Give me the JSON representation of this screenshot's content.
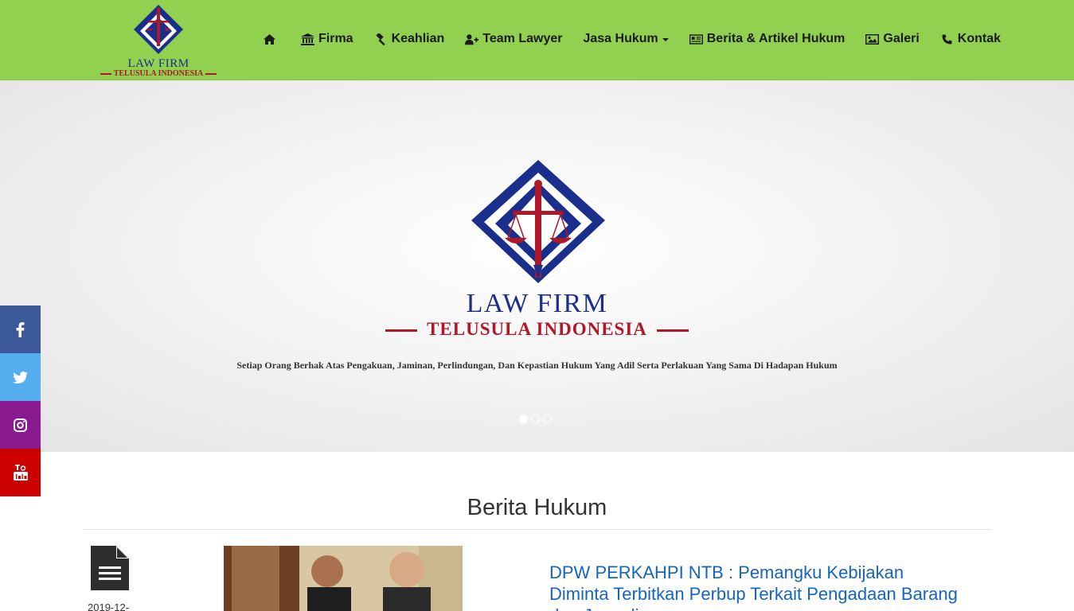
{
  "header": {
    "brand": {
      "name": "LAW FIRM",
      "sub": "TELUSULA INDONESIA"
    },
    "nav": [
      {
        "label": "",
        "icon": "home-icon"
      },
      {
        "label": "Firma",
        "icon": "institution-icon"
      },
      {
        "label": "Keahlian",
        "icon": "gavel-icon"
      },
      {
        "label": "Team Lawyer",
        "icon": "user-plus-icon"
      },
      {
        "label": "Jasa Hukum",
        "icon": "",
        "dropdown": true
      },
      {
        "label": "Berita & Artikel Hukum",
        "icon": "newspaper-icon"
      },
      {
        "label": "Galeri",
        "icon": "image-icon"
      },
      {
        "label": "Kontak",
        "icon": "phone-icon"
      }
    ]
  },
  "hero": {
    "title": "LAW FIRM",
    "subtitle": "TELUSULA INDONESIA",
    "caption": "Setiap Orang Berhak Atas Pengakuan, Jaminan, Perlindungan, Dan Kepastian Hukum Yang Adil Serta Perlakuan Yang Sama Di Hadapan Hukum",
    "slides": 3,
    "active_slide": 1
  },
  "social": [
    "facebook-icon",
    "twitter-icon",
    "instagram-icon",
    "youtube-icon"
  ],
  "news": {
    "section_title": "Berita Hukum",
    "post": {
      "date": "2019-12-",
      "title": "DPW PERKAHPI NTB : Pemangku Kebijakan Diminta Terbitkan Perbup Terkait Pengadaan Barang dan Jasa di"
    }
  },
  "colors": {
    "header_bg": "#92d050",
    "brand_blue": "#1a2e8c",
    "brand_red": "#b0182a",
    "link_blue": "#1565c0",
    "facebook": "#3b5998",
    "twitter": "#55acee",
    "instagram": "#8a1a8f",
    "youtube": "#cc0000"
  }
}
